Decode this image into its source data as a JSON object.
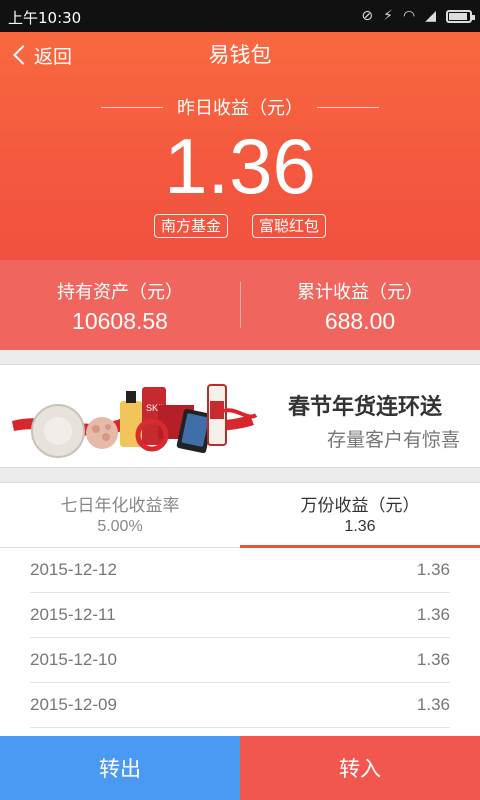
{
  "status_bar": {
    "time": "上午10:30",
    "icons": [
      "alarm-off-icon",
      "signal-off-icon",
      "wifi-icon",
      "signal-icon",
      "battery-icon"
    ]
  },
  "header": {
    "back_label": "返回",
    "title": "易钱包"
  },
  "yesterday": {
    "label": "昨日收益（元）",
    "amount": "1.36",
    "tags": [
      "南方基金",
      "富聪红包"
    ]
  },
  "summary": [
    {
      "label": "持有资产（元）",
      "value": "10608.58"
    },
    {
      "label": "累计收益（元）",
      "value": "688.00"
    }
  ],
  "banner": {
    "headline": "春节年货连环送",
    "subline": "存量客户有惊喜"
  },
  "tabs": [
    {
      "label": "七日年化收益率",
      "value": "5.00%",
      "active": false
    },
    {
      "label": "万份收益（元）",
      "value": "1.36",
      "active": true
    }
  ],
  "rows": [
    {
      "date": "2015-12-12",
      "value": "1.36"
    },
    {
      "date": "2015-12-11",
      "value": "1.36"
    },
    {
      "date": "2015-12-10",
      "value": "1.36"
    },
    {
      "date": "2015-12-09",
      "value": "1.36"
    }
  ],
  "actions": {
    "transfer_out": "转出",
    "transfer_in": "转入"
  },
  "colors": {
    "hero": "#f4583f",
    "summary": "#f0665e",
    "button_out": "#4a9af4",
    "button_in": "#f2574f"
  }
}
